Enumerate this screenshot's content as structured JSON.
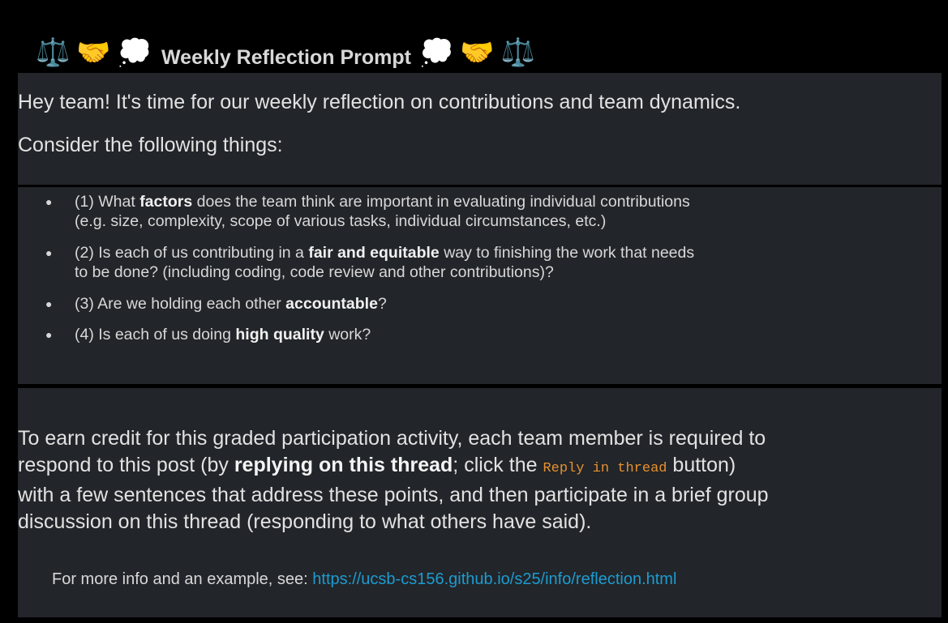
{
  "header": {
    "left_emojis": [
      "⚖️",
      "🤝",
      "💭"
    ],
    "title": "Weekly Reflection Prompt",
    "right_emojis": [
      "💭",
      "🤝",
      "⚖️"
    ]
  },
  "intro": {
    "line1": "Hey team! It's time for our weekly reflection on contributions and team dynamics.",
    "line2": "Consider the following things:"
  },
  "items": [
    {
      "pre": "(1) What ",
      "bold": "factors",
      "post": " does the team think are important in evaluating individual contributions",
      "line2": "(e.g. size, complexity, scope of various tasks, individual circumstances, etc.)"
    },
    {
      "pre": "(2) Is each of us contributing in a ",
      "bold": "fair and equitable",
      "post": " way to finishing the work that needs",
      "line2": "to be done? (including coding, code review and other contributions)?"
    },
    {
      "pre": "(3) Are we holding each other ",
      "bold": "accountable",
      "post": "?",
      "line2": ""
    },
    {
      "pre": "(4) Is each of us doing ",
      "bold": "high quality",
      "post": " work?",
      "line2": ""
    }
  ],
  "cta": {
    "l1": "To earn credit for this graded participation activity, each team member is required to",
    "l2_pre": "respond to this post (by ",
    "l2_bold": "replying on this thread",
    "l2_mid": "; click the ",
    "l2_code": "Reply in thread",
    "l2_post": " button)",
    "l3": "with a few sentences that address these points, and then participate in a brief group",
    "l4": "discussion on this thread (responding to what others have said)."
  },
  "more_info": {
    "text": "For more info and an example, see: ",
    "link": "https://ucsb-cs156.github.io/s25/info/reflection.html"
  },
  "colors": {
    "panel": "#222529",
    "link": "#1d9bd1",
    "code": "#e8912d"
  }
}
